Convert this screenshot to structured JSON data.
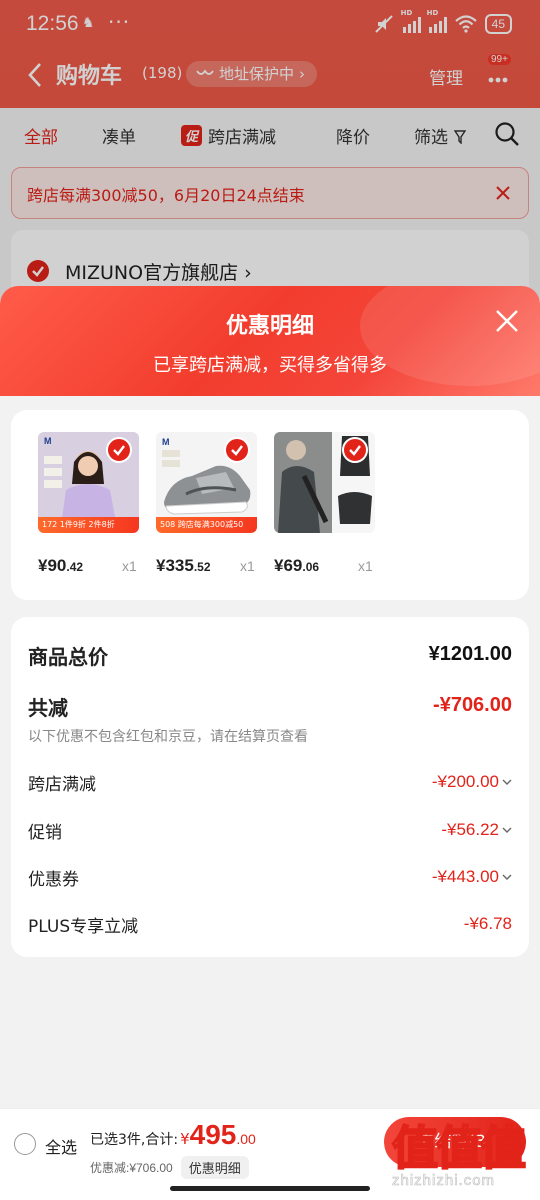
{
  "status_bar": {
    "time": "12:56",
    "dots": "···",
    "hd_label": "HD",
    "battery": "45"
  },
  "nav": {
    "title": "购物车",
    "count": "(198)",
    "address_protect": "地址保护中",
    "manage": "管理",
    "message_badge": "99+"
  },
  "tabs": {
    "all": "全部",
    "coudan": "凑单",
    "promo_tag": "促",
    "cross_store": "跨店满减",
    "price_drop": "降价",
    "filter": "筛选"
  },
  "notice": {
    "text": "跨店每满300减50，6月20日24点结束"
  },
  "store": {
    "name": "MIZUNO官方旗舰店 ›"
  },
  "sheet": {
    "title": "优惠明细",
    "subtitle": "已享跨店满减，买得多省得多"
  },
  "products": [
    {
      "price_int": "¥90",
      "price_dec": ".42",
      "qty": "x1",
      "tag": "172  1件9折 2件8折",
      "image": "model-in-lavender-sweatshirt"
    },
    {
      "price_int": "¥335",
      "price_dec": ".52",
      "qty": "x1",
      "tag": "508  跨店每满300减50",
      "image": "grey-running-shoe"
    },
    {
      "price_int": "¥69",
      "price_dec": ".06",
      "qty": "x1",
      "tag": "",
      "image": "grey-sling-bag"
    }
  ],
  "details": {
    "total_label": "商品总价",
    "total_value": "¥1201.00",
    "reduce_label": "共减",
    "reduce_value": "-¥706.00",
    "reduce_note": "以下优惠不包含红包和京豆，请在结算页查看",
    "items": [
      {
        "label": "跨店满减",
        "value": "-¥200.00"
      },
      {
        "label": "促销",
        "value": "-¥56.22"
      },
      {
        "label": "优惠券",
        "value": "-¥443.00"
      },
      {
        "label": "PLUS专享立减",
        "value": "-¥6.78"
      }
    ]
  },
  "bottom": {
    "select_all": "全选",
    "selected_total_label": "已选3件,合计:",
    "yen": "¥",
    "total_int": "495",
    "total_dec": ".00",
    "saved": "优惠减:¥706.00",
    "detail_btn": "优惠明细",
    "checkout": "去结算(3)",
    "watermark": "值值值",
    "watermark_url": "zhizhizhi.com"
  },
  "colors": {
    "accent": "#e2231a",
    "header": "#ef5a47"
  },
  "icons": [
    "back-icon",
    "address-shield-icon",
    "more-icon",
    "filter-icon",
    "search-icon",
    "close-icon",
    "check-icon",
    "chevron-down-icon"
  ]
}
